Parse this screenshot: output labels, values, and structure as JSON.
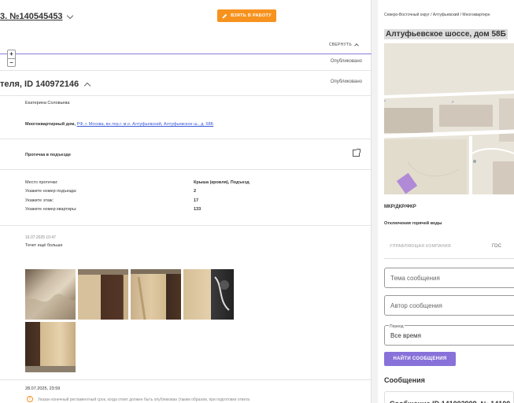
{
  "header": {
    "title": "3. №140545453",
    "take_button": "ВЗЯТЬ В РАБОТУ",
    "collapse_label": "СВЕРНУТЬ"
  },
  "rows": {
    "first_status": "Опубликовано",
    "appeal_title": "теля, ID 140972146",
    "appeal_status": "Опубликовано"
  },
  "appeal": {
    "author": "Екатерина Соловьева",
    "object_label": "Многоквартирный дом,",
    "object_address": "РФ, г. Москва, вн.тер.г. м.о. Алтуфьевский, Алтуфьевское ш., д. 58Б",
    "topic": "Протечка в подъезде",
    "fields": [
      {
        "label": "Место протечки:",
        "value": "Крыша (кровля), Подъезд"
      },
      {
        "label": "Укажите номер подъезда:",
        "value": "2"
      },
      {
        "label": "Укажите этаж:",
        "value": "17"
      },
      {
        "label": "Укажите номер квартиры:",
        "value": "133"
      }
    ],
    "comment_date": "16.07.2025 10:47",
    "comment_text": "Течет ещё больше",
    "answer_date": "28.07.2025, 23:59",
    "warning_text": "Указан конечный регламентный срок, когда ответ должен быть опубликован (таким образом, при подготовке ответа"
  },
  "side": {
    "breadcrumb": "Северо-Восточный округ / Алтуфьевский / Многоквартирн",
    "address_title": "Алтуфьевское шоссе, дом 58Б",
    "zoom_in": "+",
    "zoom_out": "−",
    "mkr_label": "МКР/ДКР/ФКР",
    "hot_water_label": "Отключения горячей воды",
    "management_label": "УПРАВЛЯЮЩАЯ КОМПАНИЯ",
    "management_value": "ГОС",
    "subject_placeholder": "Тема сообщения",
    "author_placeholder": "Автор сообщения",
    "period_legend": "Период",
    "period_value": "Все время",
    "find_button": "НАЙТИ СООБЩЕНИЯ",
    "messages_title": "Сообщения",
    "message_card": "Сообщение ID 141002909, № 14100"
  },
  "colors": {
    "accent_orange": "#f7921e",
    "accent_purple": "#8872d9",
    "link_blue": "#3b5bdb"
  }
}
